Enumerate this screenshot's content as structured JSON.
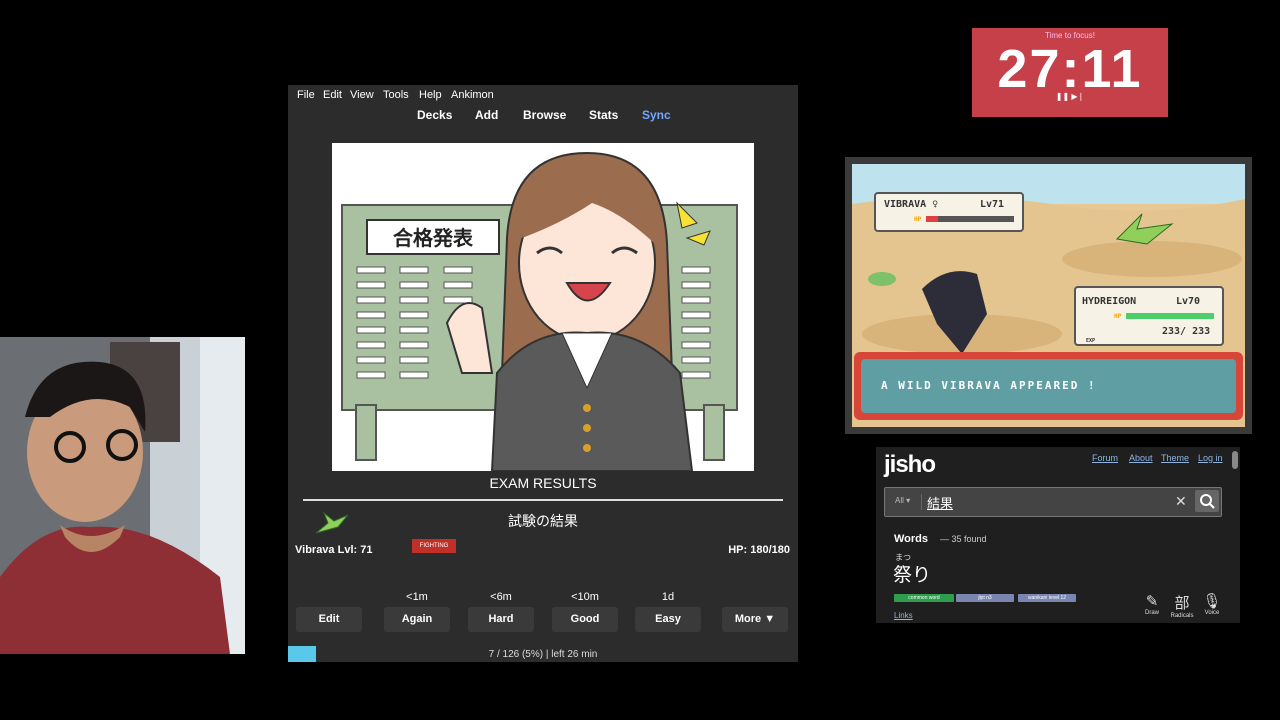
{
  "timer": {
    "label": "Time to focus!",
    "time": "27:11",
    "controls": "❚❚ ▶❘"
  },
  "anki": {
    "menu": [
      "File",
      "Edit",
      "View",
      "Tools",
      "Help",
      "Ankimon"
    ],
    "toolbar": [
      "Decks",
      "Add",
      "Browse",
      "Stats",
      "Sync"
    ],
    "card": {
      "sign_text": "合格発表",
      "title": "EXAM RESULTS",
      "japanese": "試験の結果"
    },
    "pokemon": {
      "name_level": "Vibrava Lvl: 71",
      "type": "FIGHTING",
      "hp": "HP: 180/180"
    },
    "intervals": [
      "<1m",
      "<6m",
      "<10m",
      "1d"
    ],
    "buttons": {
      "edit": "Edit",
      "again": "Again",
      "hard": "Hard",
      "good": "Good",
      "easy": "Easy",
      "more": "More ▼"
    },
    "progress": {
      "text": "7 / 126 (5%) | left 26 min",
      "fraction": 0.05
    }
  },
  "game": {
    "enemy": {
      "name": "VIBRAVA ♀",
      "level": "Lv71"
    },
    "player": {
      "name": "HYDREIGON",
      "level": "Lv70",
      "hp": "233/ 233"
    },
    "hp_label": "HP",
    "exp_label": "EXP",
    "message": "A WILD VIBRAVA APPEARED !"
  },
  "jisho": {
    "logo": "jisho",
    "links": [
      "Forum",
      "About",
      "Theme",
      "Log in"
    ],
    "search": {
      "filter": "All ▾",
      "value": "結果"
    },
    "words_heading": "Words",
    "words_count": "— 35 found",
    "result": {
      "furigana": "まつ",
      "word": "祭り"
    },
    "tags": [
      "common word",
      "jlpt n3",
      "wanikani level 12"
    ],
    "links_label": "Links",
    "tools": [
      {
        "label": "Draw",
        "glyph": "✎"
      },
      {
        "label": "Radicals",
        "glyph": "部"
      },
      {
        "label": "Voice",
        "glyph": "🎙"
      }
    ]
  },
  "colors": {
    "sync": "#6fa8ff",
    "timer_bg": "#c6404a",
    "fighting": "#c03028",
    "progress": "#5ac8e8"
  }
}
